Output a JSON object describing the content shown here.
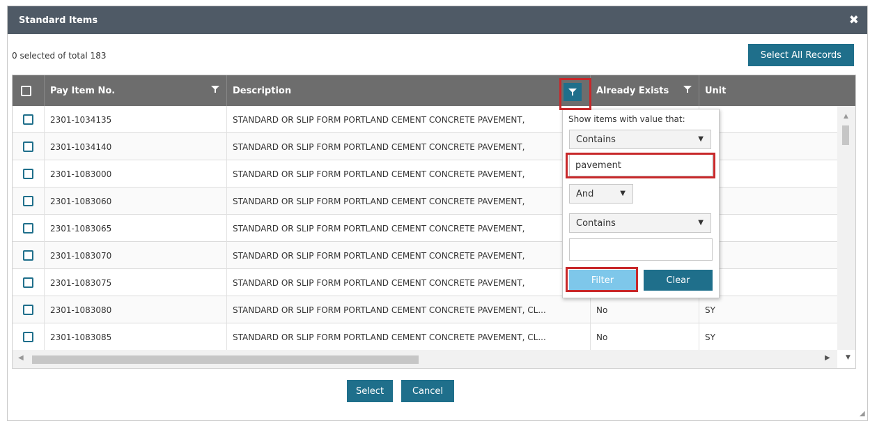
{
  "dialog": {
    "title": "Standard Items",
    "close_glyph": "✖"
  },
  "toolbar": {
    "selection_count": "0 selected of total 183",
    "select_all_label": "Select All Records"
  },
  "grid": {
    "columns": [
      "Pay Item No.",
      "Description",
      "Already Exists",
      "Unit"
    ],
    "rows": [
      {
        "pay_item_no": "2301-1034135",
        "description": "STANDARD OR SLIP FORM PORTLAND CEMENT CONCRETE PAVEMENT,",
        "already_exists": "",
        "unit": ""
      },
      {
        "pay_item_no": "2301-1034140",
        "description": "STANDARD OR SLIP FORM PORTLAND CEMENT CONCRETE PAVEMENT,",
        "already_exists": "",
        "unit": ""
      },
      {
        "pay_item_no": "2301-1083000",
        "description": "STANDARD OR SLIP FORM PORTLAND CEMENT CONCRETE PAVEMENT,",
        "already_exists": "",
        "unit": ""
      },
      {
        "pay_item_no": "2301-1083060",
        "description": "STANDARD OR SLIP FORM PORTLAND CEMENT CONCRETE PAVEMENT,",
        "already_exists": "",
        "unit": ""
      },
      {
        "pay_item_no": "2301-1083065",
        "description": "STANDARD OR SLIP FORM PORTLAND CEMENT CONCRETE PAVEMENT,",
        "already_exists": "",
        "unit": ""
      },
      {
        "pay_item_no": "2301-1083070",
        "description": "STANDARD OR SLIP FORM PORTLAND CEMENT CONCRETE PAVEMENT,",
        "already_exists": "",
        "unit": ""
      },
      {
        "pay_item_no": "2301-1083075",
        "description": "STANDARD OR SLIP FORM PORTLAND CEMENT CONCRETE PAVEMENT,",
        "already_exists": "",
        "unit": ""
      },
      {
        "pay_item_no": "2301-1083080",
        "description": "STANDARD OR SLIP FORM PORTLAND CEMENT CONCRETE PAVEMENT, CL...",
        "already_exists": "No",
        "unit": "SY"
      },
      {
        "pay_item_no": "2301-1083085",
        "description": "STANDARD OR SLIP FORM PORTLAND CEMENT CONCRETE PAVEMENT, CL...",
        "already_exists": "No",
        "unit": "SY"
      }
    ]
  },
  "filter_popup": {
    "hint": "Show items with value that:",
    "operator1": "Contains",
    "value1": "pavement",
    "logic": "And",
    "operator2": "Contains",
    "value2": "",
    "filter_label": "Filter",
    "clear_label": "Clear"
  },
  "footer": {
    "select_label": "Select",
    "cancel_label": "Cancel"
  },
  "colors": {
    "titlebar": "#4f5a66",
    "header": "#6d6d6d",
    "primary": "#1f6f8b",
    "highlight": "#c8282a",
    "filter_button": "#7ec7ea"
  }
}
